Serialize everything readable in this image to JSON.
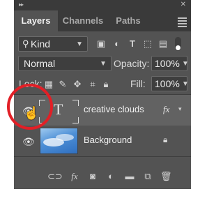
{
  "tabs": [
    {
      "label": "Layers"
    },
    {
      "label": "Channels"
    },
    {
      "label": "Paths"
    }
  ],
  "filter": {
    "kind_label": "Kind"
  },
  "blend": {
    "mode": "Normal",
    "opacity_label": "Opacity:",
    "opacity_value": "100%"
  },
  "lock": {
    "label": "Lock:",
    "fill_label": "Fill:",
    "fill_value": "100%"
  },
  "layers": [
    {
      "name": "creative clouds",
      "thumb_glyph": "T",
      "fx_label": "fx"
    },
    {
      "name": "Background"
    }
  ],
  "footer": {
    "fx_label": "fx"
  },
  "colors": {
    "panel": "#535353",
    "selected_row": "#626262",
    "highlight_circle": "#e21f26"
  }
}
